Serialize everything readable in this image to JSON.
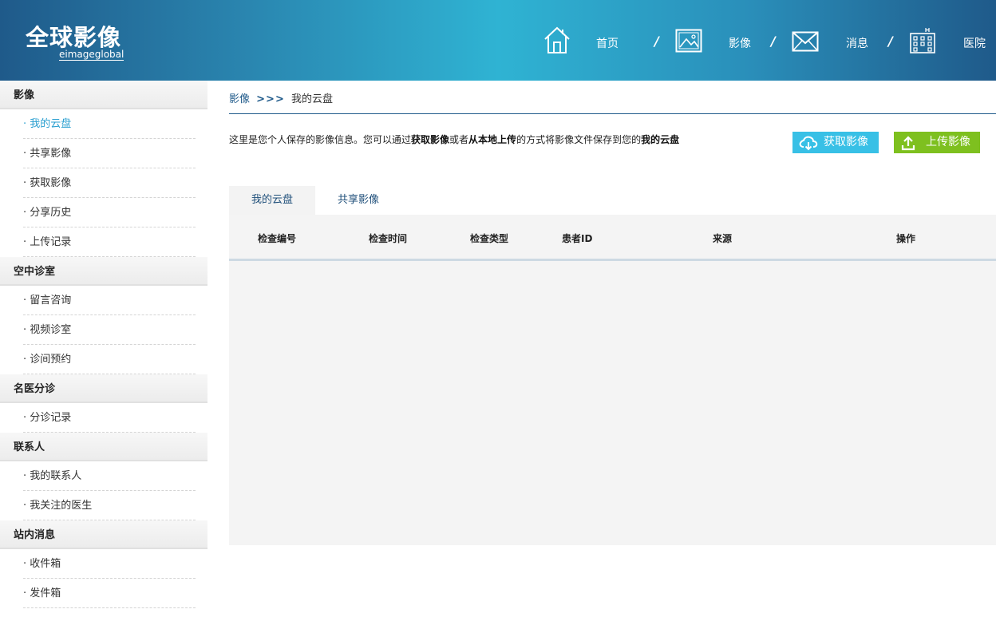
{
  "logo": {
    "cn": "全球影像",
    "en": "eimageglobal"
  },
  "nav": {
    "items": [
      {
        "label": "首页",
        "icon": "home-icon"
      },
      {
        "label": "影像",
        "icon": "image-icon"
      },
      {
        "label": "消息",
        "icon": "envelope-icon"
      },
      {
        "label": "医院",
        "icon": "hospital-icon"
      }
    ],
    "separator": "/"
  },
  "sidebar": {
    "groups": [
      {
        "title": "影像",
        "items": [
          "· 我的云盘",
          "· 共享影像",
          "· 获取影像",
          "· 分享历史",
          "· 上传记录"
        ]
      },
      {
        "title": "空中诊室",
        "items": [
          "· 留言咨询",
          "· 视频诊室",
          "· 诊间预约"
        ]
      },
      {
        "title": "名医分诊",
        "items": [
          "· 分诊记录"
        ]
      },
      {
        "title": "联系人",
        "items": [
          "· 我的联系人",
          "· 我关注的医生"
        ]
      },
      {
        "title": "站内消息",
        "items": [
          "· 收件箱",
          "· 发件箱"
        ]
      }
    ],
    "active": "· 我的云盘"
  },
  "breadcrumb": {
    "parent": "影像",
    "sep": ">>>",
    "current": "我的云盘"
  },
  "intro": {
    "t1": "这里是您个人保存的影像信息。您可以通过",
    "b1": "获取影像",
    "t2": "或者",
    "b2": "从本地上传",
    "t3": "的方式将影像文件保存到您的",
    "b3": "我的云盘"
  },
  "buttons": {
    "get": "获取影像",
    "upload": "上传影像"
  },
  "tabs": [
    "我的云盘",
    "共享影像"
  ],
  "table": {
    "columns": [
      "检查编号",
      "检查时间",
      "检查类型",
      "患者ID",
      "来源",
      "操作"
    ],
    "rows": []
  },
  "colors": {
    "accent": "#2a9fd0",
    "get_button": "#38c0e6",
    "upload_button": "#7ec01f",
    "nav_dark": "#1f5a8a"
  }
}
